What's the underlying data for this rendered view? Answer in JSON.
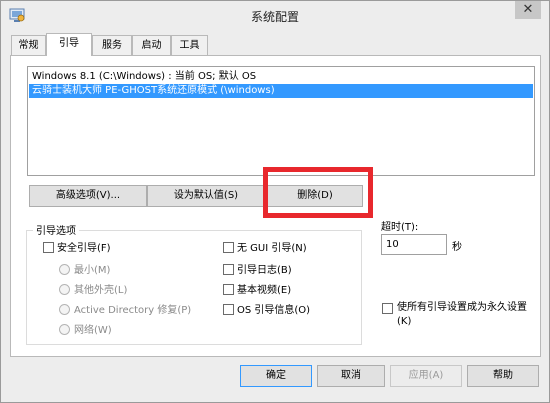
{
  "window": {
    "title": "系统配置",
    "close_glyph": "✕"
  },
  "tabs": [
    {
      "label": "常规"
    },
    {
      "label": "引导"
    },
    {
      "label": "服务"
    },
    {
      "label": "启动"
    },
    {
      "label": "工具"
    }
  ],
  "os_list": [
    {
      "label": "Windows 8.1 (C:\\Windows) : 当前 OS; 默认 OS"
    },
    {
      "label": "云骑士装机大师 PE-GHOST系统还原模式 (\\windows)"
    }
  ],
  "list_buttons": {
    "advanced": "高级选项(V)...",
    "set_default": "设为默认值(S)",
    "delete": "删除(D)"
  },
  "boot_options": {
    "title": "引导选项",
    "safe_boot": "安全引导(F)",
    "minimal": "最小(M)",
    "alternate_shell": "其他外壳(L)",
    "ad_repair": "Active Directory 修复(P)",
    "network": "网络(W)",
    "no_gui": "无 GUI 引导(N)",
    "boot_log": "引导日志(B)",
    "base_video": "基本视频(E)",
    "os_info": "OS 引导信息(O)"
  },
  "timeout": {
    "label": "超时(T):",
    "value": "10",
    "unit": "秒"
  },
  "make_permanent": "使所有引导设置成为永久设置(K)",
  "footer": {
    "ok": "确定",
    "cancel": "取消",
    "apply": "应用(A)",
    "help": "帮助"
  },
  "colors": {
    "selection": "#3399ff",
    "highlight_box": "#e8282d"
  }
}
